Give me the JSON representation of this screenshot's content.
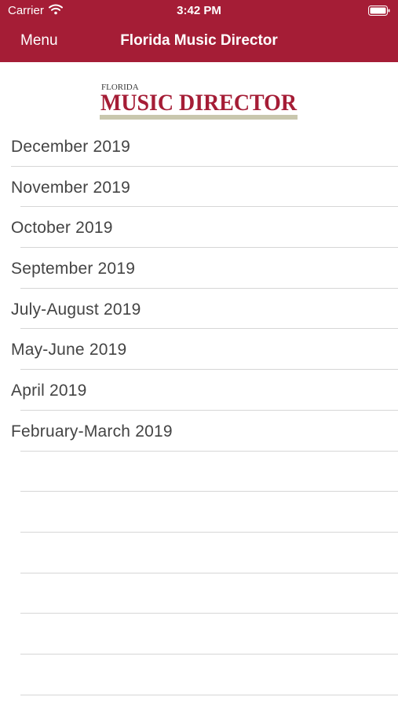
{
  "status_bar": {
    "carrier": "Carrier",
    "time": "3:42 PM",
    "wifi_icon": "wifi-icon",
    "battery_icon": "battery-icon"
  },
  "nav": {
    "menu_label": "Menu",
    "title": "Florida Music Director"
  },
  "logo": {
    "small_text": "FLORIDA",
    "main_text": "MUSIC DIRECTOR",
    "brand_color": "#a51d36"
  },
  "issues": [
    {
      "label": "December 2019"
    },
    {
      "label": "November 2019"
    },
    {
      "label": "October 2019"
    },
    {
      "label": "September 2019"
    },
    {
      "label": "July-August 2019"
    },
    {
      "label": "May-June 2019"
    },
    {
      "label": "April 2019"
    },
    {
      "label": "February-March 2019"
    }
  ],
  "colors": {
    "header_bg": "#a51d36",
    "text": "#444444",
    "separator": "#d6d6d6"
  }
}
